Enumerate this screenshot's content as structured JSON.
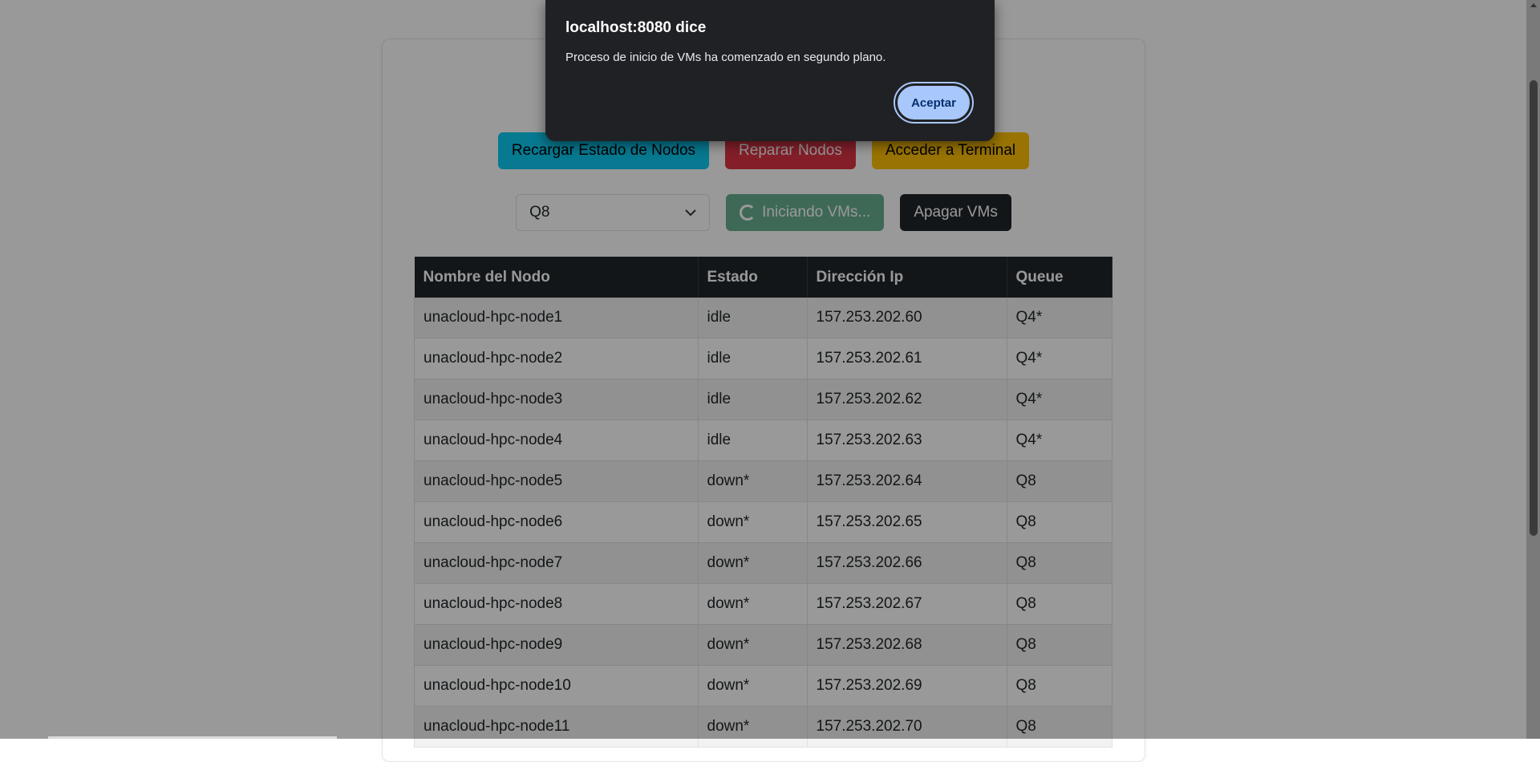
{
  "toolbar": {
    "reload_label": "Recargar Estado de Nodos",
    "repair_label": "Reparar Nodos",
    "terminal_label": "Acceder a Terminal",
    "queue_selected": "Q8",
    "start_label": "Iniciando VMs...",
    "stop_label": "Apagar VMs"
  },
  "table": {
    "headers": [
      "Nombre del Nodo",
      "Estado",
      "Dirección Ip",
      "Queue"
    ],
    "rows": [
      [
        "unacloud-hpc-node1",
        "idle",
        "157.253.202.60",
        "Q4*"
      ],
      [
        "unacloud-hpc-node2",
        "idle",
        "157.253.202.61",
        "Q4*"
      ],
      [
        "unacloud-hpc-node3",
        "idle",
        "157.253.202.62",
        "Q4*"
      ],
      [
        "unacloud-hpc-node4",
        "idle",
        "157.253.202.63",
        "Q4*"
      ],
      [
        "unacloud-hpc-node5",
        "down*",
        "157.253.202.64",
        "Q8"
      ],
      [
        "unacloud-hpc-node6",
        "down*",
        "157.253.202.65",
        "Q8"
      ],
      [
        "unacloud-hpc-node7",
        "down*",
        "157.253.202.66",
        "Q8"
      ],
      [
        "unacloud-hpc-node8",
        "down*",
        "157.253.202.67",
        "Q8"
      ],
      [
        "unacloud-hpc-node9",
        "down*",
        "157.253.202.68",
        "Q8"
      ],
      [
        "unacloud-hpc-node10",
        "down*",
        "157.253.202.69",
        "Q8"
      ],
      [
        "unacloud-hpc-node11",
        "down*",
        "157.253.202.70",
        "Q8"
      ]
    ]
  },
  "dialog": {
    "title": "localhost:8080 dice",
    "message": "Proceso de inicio de VMs ha comenzado en segundo plano.",
    "accept_label": "Aceptar"
  },
  "colors": {
    "info": "#0dcaf0",
    "danger": "#dc3545",
    "warning": "#ffc107",
    "success": "#198754",
    "dark": "#212529",
    "dialog_bg": "#202124",
    "dialog_button": "#a8c7fa"
  },
  "icons": {
    "select_caret": "chevron-down-icon",
    "loading": "spinner-icon"
  }
}
